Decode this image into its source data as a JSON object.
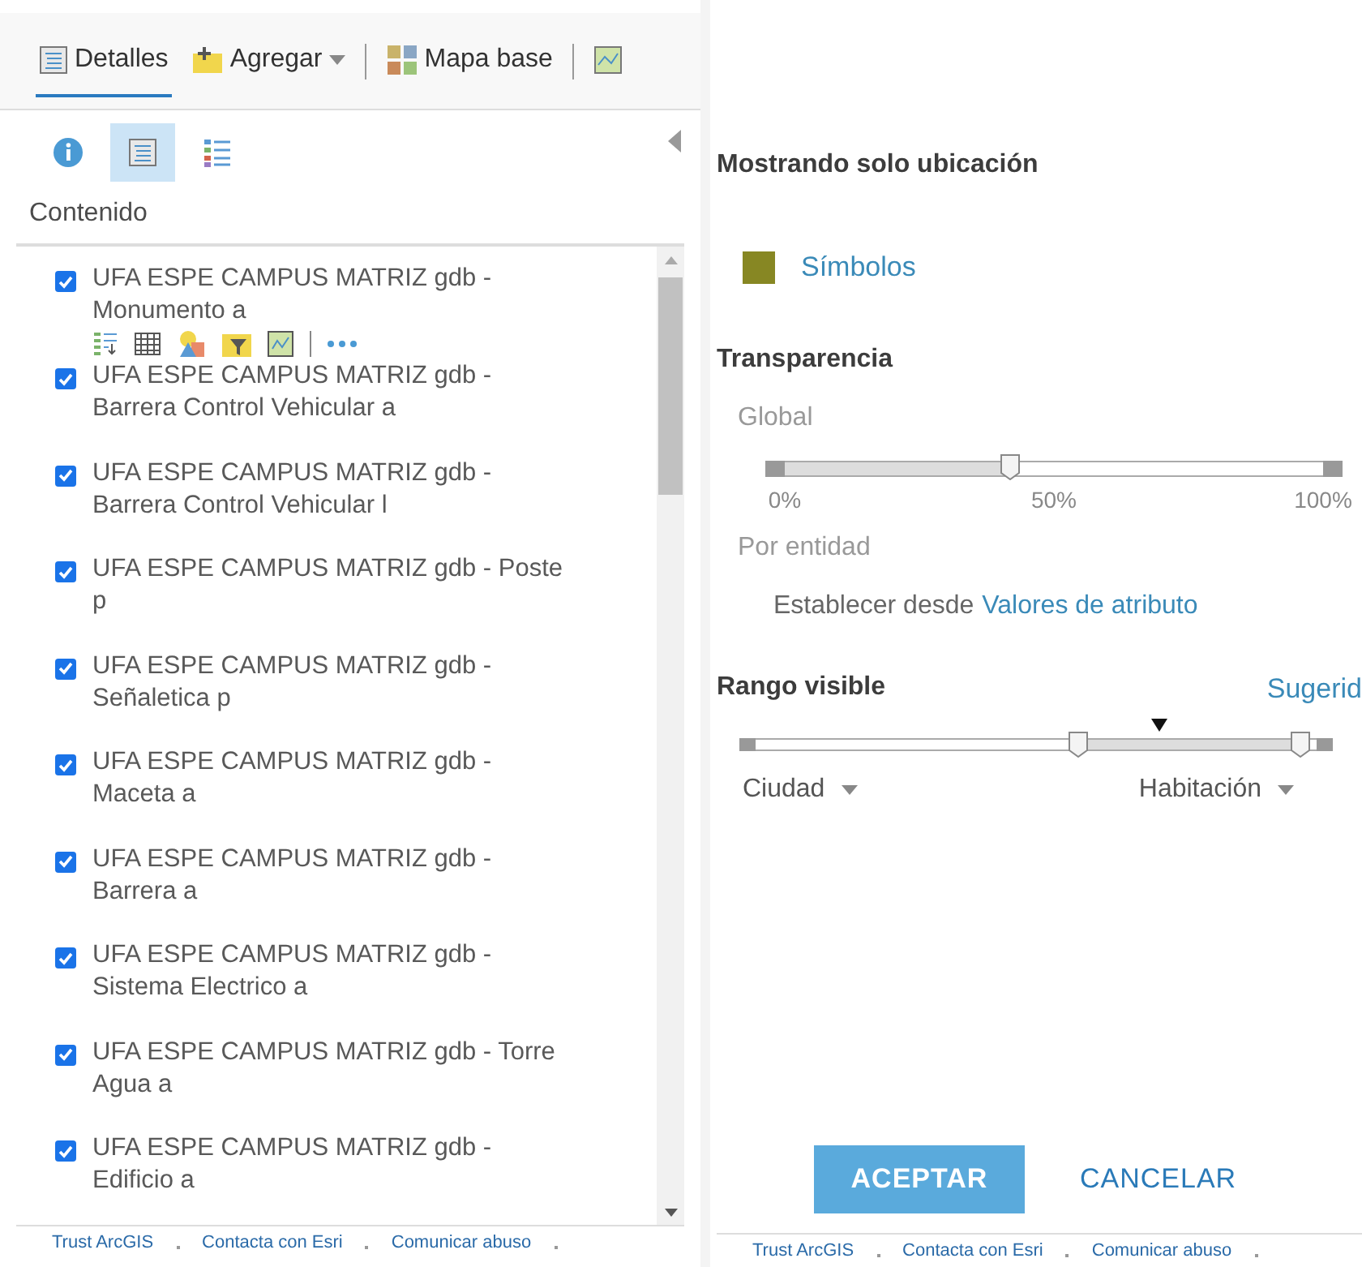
{
  "toolbar": {
    "tabs": [
      {
        "label": "Detalles",
        "kind": "details",
        "selected": true
      },
      {
        "label": "Agregar",
        "kind": "add",
        "selected": false
      },
      {
        "label": "Mapa base",
        "kind": "basemap",
        "selected": false
      },
      {
        "kind": "map",
        "selected": false
      }
    ]
  },
  "view_tabs": [
    {
      "kind": "info",
      "selected": false
    },
    {
      "kind": "content",
      "selected": true
    },
    {
      "kind": "legend",
      "selected": false
    }
  ],
  "contents": {
    "title": "Contenido",
    "layers": [
      {
        "line1": "UFA ESPE CAMPUS MATRIZ gdb -",
        "line2": "Monumento a",
        "checked": true,
        "expanded": true
      },
      {
        "line1": "UFA ESPE CAMPUS MATRIZ gdb -",
        "line2": "Barrera Control Vehicular a",
        "checked": true,
        "expanded": false
      },
      {
        "line1": "UFA ESPE CAMPUS MATRIZ gdb -",
        "line2": "Barrera Control Vehicular l",
        "checked": true,
        "expanded": false
      },
      {
        "line1": "UFA ESPE CAMPUS MATRIZ gdb - Poste",
        "line2": "p",
        "checked": true,
        "expanded": false
      },
      {
        "line1": "UFA ESPE CAMPUS MATRIZ gdb -",
        "line2": "Señaletica p",
        "checked": true,
        "expanded": false
      },
      {
        "line1": "UFA ESPE CAMPUS MATRIZ gdb -",
        "line2": "Maceta a",
        "checked": true,
        "expanded": false
      },
      {
        "line1": "UFA ESPE CAMPUS MATRIZ gdb -",
        "line2": "Barrera a",
        "checked": true,
        "expanded": false
      },
      {
        "line1": "UFA ESPE CAMPUS MATRIZ gdb -",
        "line2": "Sistema Electrico a",
        "checked": true,
        "expanded": false
      },
      {
        "line1": "UFA ESPE CAMPUS MATRIZ gdb - Torre",
        "line2": "Agua a",
        "checked": true,
        "expanded": false
      },
      {
        "line1": "UFA ESPE CAMPUS MATRIZ gdb -",
        "line2": "Edificio a",
        "checked": true,
        "expanded": false
      }
    ]
  },
  "style_panel": {
    "heading": "Mostrando solo ubicación",
    "symbol": {
      "label": "Símbolos",
      "color": "#878723"
    },
    "transparency": {
      "title": "Transparencia",
      "global_label": "Global",
      "level": 0.42,
      "ticks": [
        "0%",
        "50%",
        "100%"
      ],
      "per_feature_label": "Por entidad",
      "set_from": "Establecer desde",
      "set_from_link": "Valores de atributo"
    },
    "visible_range": {
      "title": "Rango visible",
      "suggested": "Sugerid",
      "handles": [
        {
          "level": 0.575
        },
        {
          "level": 0.97
        }
      ],
      "marker": {
        "level": 0.72
      },
      "min": "Ciudad",
      "max": "Habitación"
    },
    "buttons": [
      {
        "label": "ACEPTAR",
        "kind": "primary"
      },
      {
        "label": "CANCELAR",
        "kind": "link"
      }
    ]
  },
  "footer_left": [
    "Trust ArcGIS",
    "Contacta con Esri",
    "Comunicar abuso"
  ],
  "footer_right": [
    "Trust ArcGIS",
    "Contacta con Esri",
    "Comunicar abuso"
  ]
}
